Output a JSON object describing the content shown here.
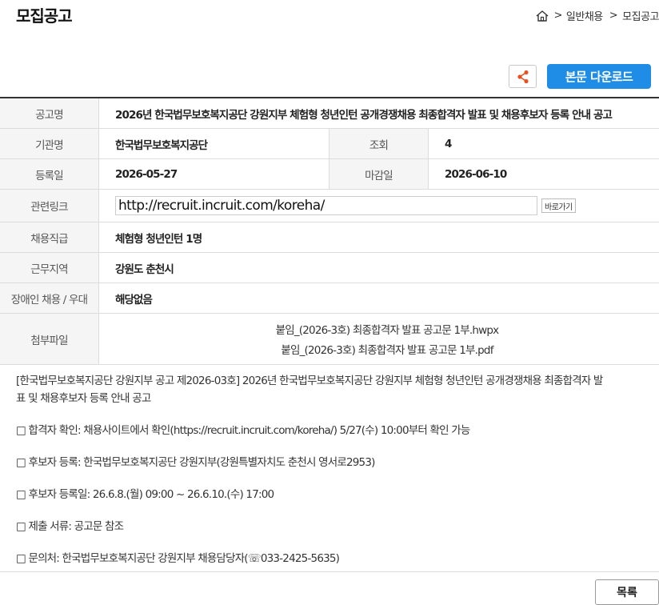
{
  "header": {
    "title": "모집공고",
    "breadcrumb": {
      "separator": ">",
      "level1": "일반채용",
      "level2": "모집공고"
    }
  },
  "actions": {
    "share_icon": "share-icon",
    "download_label": "본문 다운로드",
    "accent_color": "#1f8ce6"
  },
  "info": {
    "title_label": "공고명",
    "title_value": "2026년 한국법무보호복지공단 강원지부 체험형 청년인턴 공개경쟁채용 최종합격자 발표 및 채용후보자 등록 안내 공고",
    "org_label": "기관명",
    "org_value": "한국법무보호복지공단",
    "views_label": "조회",
    "views_value": "4",
    "reg_label": "등록일",
    "reg_value": "2026-05-27",
    "deadline_label": "마감일",
    "deadline_value": "2026-06-10",
    "link_label": "관련링크",
    "link_value": "http://recruit.incruit.com/koreha/",
    "goto_label": "바로가기",
    "job_label": "채용직급",
    "job_value": "체험형 청년인턴 1명",
    "region_label": "근무지역",
    "region_value": "강원도 춘천시",
    "disabled_label": "장애인 채용 / 우대",
    "disabled_value": "해당없음",
    "files_label": "첨부파일",
    "files": [
      "붙임_(2026-3호) 최종합격자 발표 공고문 1부.hwpx",
      "붙임_(2026-3호) 최종합격자 발표 공고문 1부.pdf"
    ]
  },
  "body": {
    "intro_line1": "[한국법무보호복지공단 강원지부 공고 제2026-03호] 2026년 한국법무보호복지공단 강원지부 체험형 청년인턴 공개경쟁채용 최종합격자 발",
    "intro_line2": "표 및 채용후보자 등록 안내 공고",
    "item1": "□ 합격자 확인: 채용사이트에서 확인(https://recruit.incruit.com/koreha/) 5/27(수) 10:00부터 확인 가능",
    "item2": "□ 후보자 등록: 한국법무보호복지공단 강원지부(강원특별자치도 춘천시 영서로2953)",
    "item3": "□ 후보자 등록일: 26.6.8.(월) 09:00 ~ 26.6.10.(수) 17:00",
    "item4": "□ 제출 서류: 공고문 참조",
    "item5": "□ 문의처: 한국법무보호복지공단 강원지부 채용담당자(☏033-2425-5635)"
  },
  "footer": {
    "list_label": "목록"
  }
}
